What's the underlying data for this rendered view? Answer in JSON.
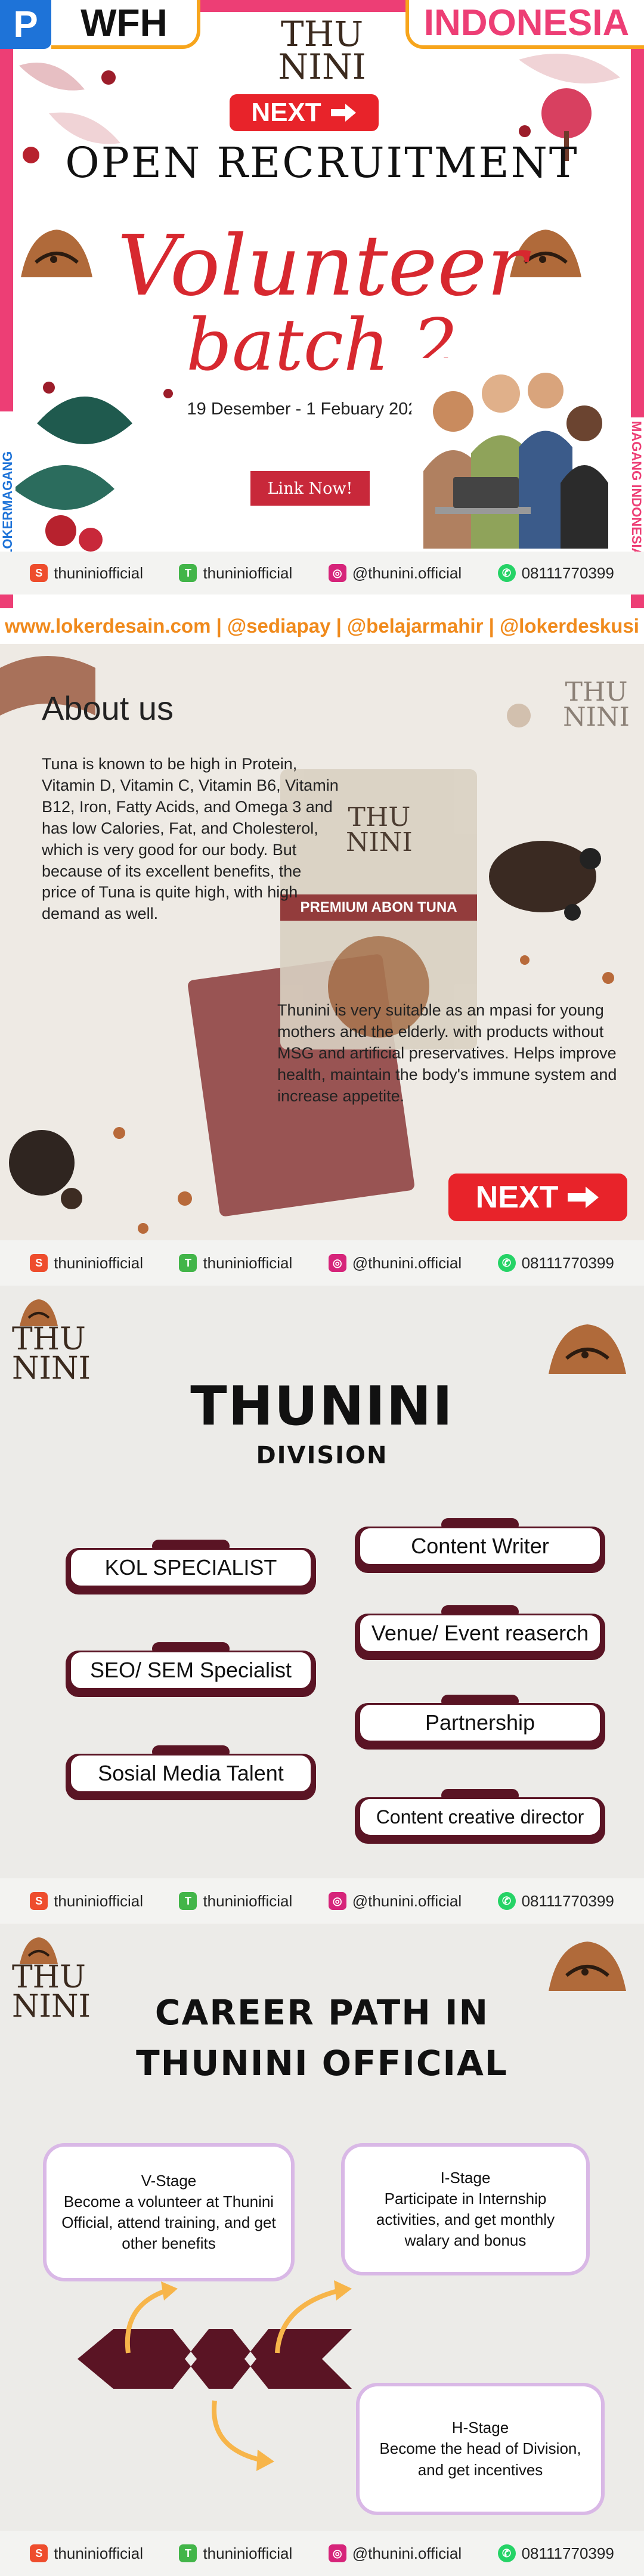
{
  "header": {
    "badge_p": "P",
    "badge_wfh": "WFH",
    "badge_indonesia": "INDONESIA",
    "logo_line1": "THU",
    "logo_line2": "NINI",
    "next_label": "NEXT",
    "open_recruitment": "OPEN RECRUITMENT",
    "volunteer": "Volunteer",
    "batch": "batch 2",
    "date_range": "19 Desember - 1 Febuary 2023",
    "link_button": "Link Now!",
    "side_left": "LOKERMAGANG",
    "side_right": "MAGANG INDONESIA"
  },
  "footer": {
    "shopee": "thuniniofficial",
    "tokopedia": "thuniniofficial",
    "instagram": "@thunini.official",
    "whatsapp": "08111770399"
  },
  "web_bar": "www.lokerdesain.com | @sediapay | @belajarmahir | @lokerdeskusi",
  "about": {
    "title": "About us",
    "para1": "Tuna is known to be high in Protein, Vitamin D, Vitamin C, Vitamin B6, Vitamin B12, Iron, Fatty Acids, and Omega 3 and has low Calories, Fat, and Cholesterol, which is very good for our body. But because of its excellent benefits, the price of Tuna is quite high, with high demand as well.",
    "para2": "Thunini is very suitable as an mpasi for young mothers and the elderly. with products without MSG and artificial preservatives. Helps improve health, maintain the body's immune system and increase appetite.",
    "next_label": "NEXT",
    "pack_brand1": "THU",
    "pack_brand2": "NINI",
    "pack_label": "PREMIUM ABON TUNA"
  },
  "division": {
    "title": "THUNINI",
    "subtitle": "DIVISION",
    "logo_line1": "THU",
    "logo_line2": "NINI",
    "roles_left": [
      "KOL SPECIALIST",
      "SEO/ SEM Specialist",
      "Sosial Media Talent"
    ],
    "roles_right": [
      "Content Writer",
      "Venue/ Event reaserch",
      "Partnership",
      "Content creative director"
    ]
  },
  "career": {
    "title_line1": "CAREER PATH IN",
    "title_line2": "THUNINI OFFICIAL",
    "logo_line1": "THU",
    "logo_line2": "NINI",
    "stages": [
      {
        "name": "V-Stage",
        "desc": "Become a volunteer at Thunini Official, attend training, and get other benefits"
      },
      {
        "name": "I-Stage",
        "desc": "Participate in Internship activities, and get monthly walary and bonus"
      },
      {
        "name": "H-Stage",
        "desc": "Become the head of Division, and get incentives"
      }
    ]
  },
  "colors": {
    "pink_frame": "#ed3e75",
    "maroon": "#5a1424",
    "red": "#e8232a",
    "orange": "#f08a1c"
  }
}
